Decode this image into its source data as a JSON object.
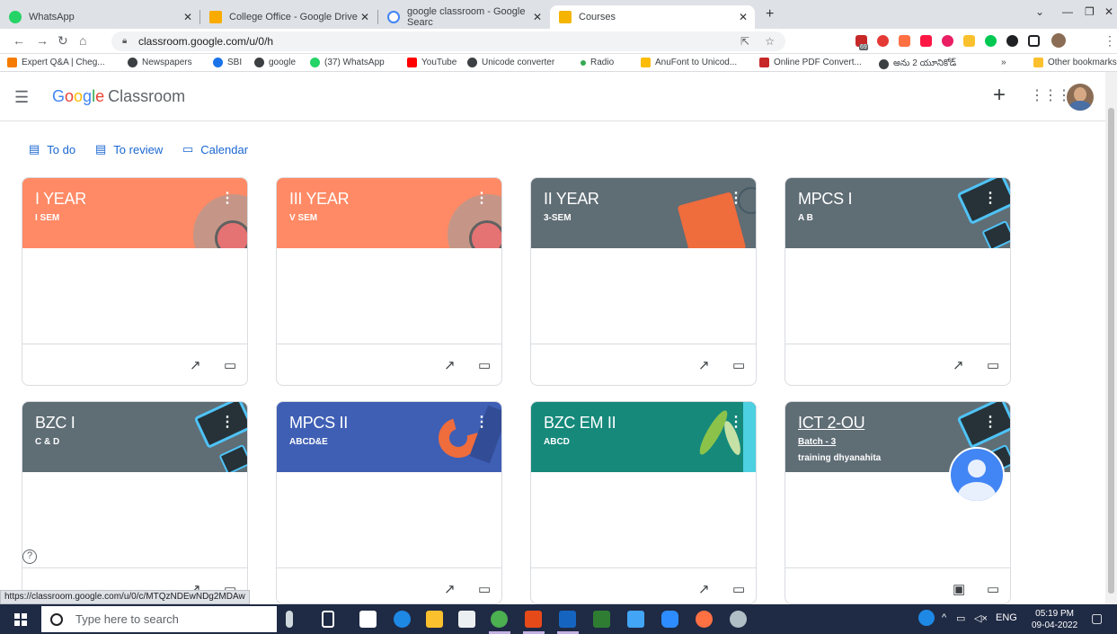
{
  "browser": {
    "tabs": [
      {
        "label": "WhatsApp",
        "fav_color": "#25d366"
      },
      {
        "label": "College Office - Google Drive",
        "fav_color": "#f9ab00"
      },
      {
        "label": "google classroom - Google Searc",
        "fav_color": "#4285f4"
      },
      {
        "label": "Courses",
        "fav_color": "#f4b400"
      }
    ],
    "url": "classroom.google.com/u/0/h",
    "bookmarks": [
      {
        "label": "Expert Q&A | Cheg...",
        "color": "#f57c00"
      },
      {
        "label": "Newspapers",
        "color": "#3c4043"
      },
      {
        "label": "SBI",
        "color": "#1a73e8"
      },
      {
        "label": "google",
        "color": "#3c4043"
      },
      {
        "label": "(37) WhatsApp",
        "color": "#25d366"
      },
      {
        "label": "YouTube",
        "color": "#ff0000"
      },
      {
        "label": "Unicode converter",
        "color": "#3c4043"
      },
      {
        "label": "Radio",
        "color": "#34a853"
      },
      {
        "label": "AnuFont to Unicod...",
        "color": "#fbbc05"
      },
      {
        "label": "Online PDF Convert...",
        "color": "#c62828"
      },
      {
        "label": "అను 2 యూనికోడ్",
        "color": "#3c4043"
      }
    ],
    "bookmarks_more": "»",
    "other_bookmarks": "Other bookmarks",
    "ext_badge": "69"
  },
  "header": {
    "logo_google": [
      "G",
      "o",
      "o",
      "g",
      "l",
      "e"
    ],
    "logo_classroom": "Classroom"
  },
  "nav_links": {
    "todo": "To do",
    "toreview": "To review",
    "calendar": "Calendar"
  },
  "cards": [
    {
      "title": "I YEAR",
      "subtitle": "I SEM",
      "color": "#ff8a65"
    },
    {
      "title": "III YEAR",
      "subtitle": "V SEM",
      "color": "#ff8a65"
    },
    {
      "title": "II YEAR",
      "subtitle": "3-SEM",
      "color": "#5f6d75"
    },
    {
      "title": "MPCS I",
      "subtitle": "A B",
      "color": "#5f6d75"
    },
    {
      "title": "BZC I",
      "subtitle": "C & D",
      "color": "#5f6d75"
    },
    {
      "title": "MPCS II",
      "subtitle": "ABCD&E",
      "color": "#3f5fb5"
    },
    {
      "title": "BZC EM II",
      "subtitle": "ABCD",
      "color": "#16897b"
    },
    {
      "title": "ICT 2-OU",
      "subtitle": "Batch - 3",
      "subtitle2": "training dhyanahita",
      "color": "#5f6d75"
    }
  ],
  "status_url": "https://classroom.google.com/u/0/c/MTQzNDEwNDg2MDAw",
  "taskbar": {
    "search_placeholder": "Type here to search",
    "lang": "ENG",
    "time": "05:19 PM",
    "date": "09-04-2022"
  }
}
